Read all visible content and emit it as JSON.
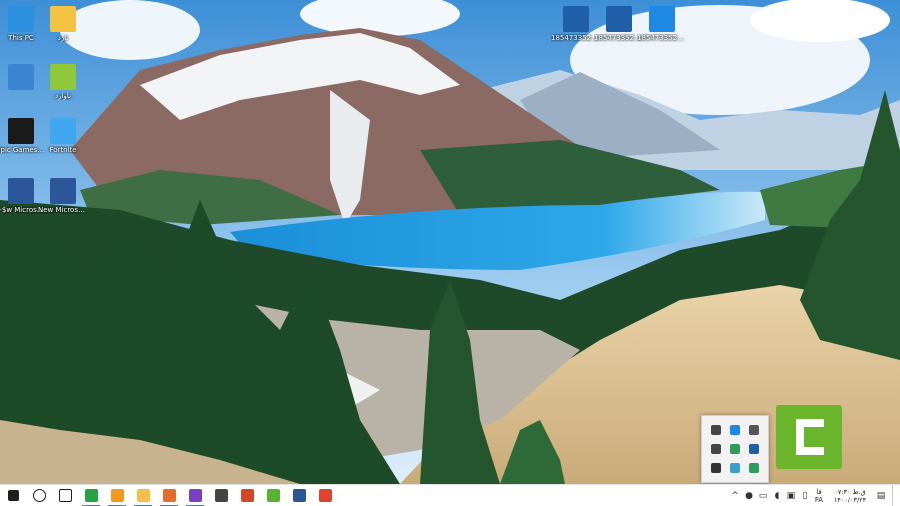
{
  "desktop": {
    "icons": [
      {
        "label": "This PC",
        "icon": "this-pc-icon",
        "color": "#2d8fe0"
      },
      {
        "label": "نارد",
        "icon": "file-icon",
        "color": "#f2c342"
      },
      {
        "label": "",
        "icon": "recycle-bin-icon",
        "color": "#3b86d1"
      },
      {
        "label": "ناوارد",
        "icon": "shortcut-icon",
        "color": "#8fc93b"
      },
      {
        "label": "Epic Games Launcher",
        "icon": "epic-games-icon",
        "color": "#1a1a1a"
      },
      {
        "label": "Fortnite",
        "icon": "fortnite-icon",
        "color": "#41a6f0"
      },
      {
        "label": "~$w Microsof...",
        "icon": "word-doc-icon",
        "color": "#2b579a"
      },
      {
        "label": "New Microsof...",
        "icon": "word-doc-icon",
        "color": "#2b579a"
      },
      {
        "label": "1854733527...",
        "icon": "audio-file-icon",
        "color": "#1e5fa8"
      },
      {
        "label": "1854733527...",
        "icon": "audio-file-icon",
        "color": "#1e5fa8"
      },
      {
        "label": "1854733527...",
        "icon": "mp3-file-icon",
        "color": "#1e88e5"
      }
    ]
  },
  "tray_flyout": {
    "icons": [
      "usb-icon",
      "globe-icon",
      "eye-icon",
      "hide-icon",
      "antivirus-icon",
      "network-globe-icon",
      "printer-icon",
      "refresh-icon",
      "shield-icon"
    ]
  },
  "taskbar": {
    "apps": [
      {
        "name": "start",
        "icon": "windows-start-icon",
        "color": "#1f1f1f"
      },
      {
        "name": "search",
        "icon": "search-icon",
        "color": "#1f1f1f"
      },
      {
        "name": "task-view",
        "icon": "task-view-icon",
        "color": "#1f1f1f"
      },
      {
        "name": "whatsapp",
        "icon": "whatsapp-icon",
        "color": "#25a244"
      },
      {
        "name": "edge",
        "icon": "edge-icon",
        "color": "#f39a1e"
      },
      {
        "name": "file-explorer",
        "icon": "folder-icon",
        "color": "#f4c04b"
      },
      {
        "name": "firefox",
        "icon": "firefox-icon",
        "color": "#e66a2c"
      },
      {
        "name": "visual-studio",
        "icon": "visual-studio-icon",
        "color": "#7b3fc4"
      },
      {
        "name": "calendar",
        "icon": "calendar-icon",
        "color": "#444444"
      },
      {
        "name": "powerpoint",
        "icon": "powerpoint-icon",
        "color": "#d24726"
      },
      {
        "name": "camtasia-green",
        "icon": "camtasia-icon",
        "color": "#59b232"
      },
      {
        "name": "word",
        "icon": "word-icon",
        "color": "#2b579a"
      },
      {
        "name": "camtasia-red",
        "icon": "camtasia-recorder-icon",
        "color": "#e1442e"
      }
    ],
    "language": "فا\nFA",
    "clock_time": "ق.ظ ۰۷:۳۰",
    "clock_date": "۱۴۰۰/۰۳/۲۴"
  }
}
